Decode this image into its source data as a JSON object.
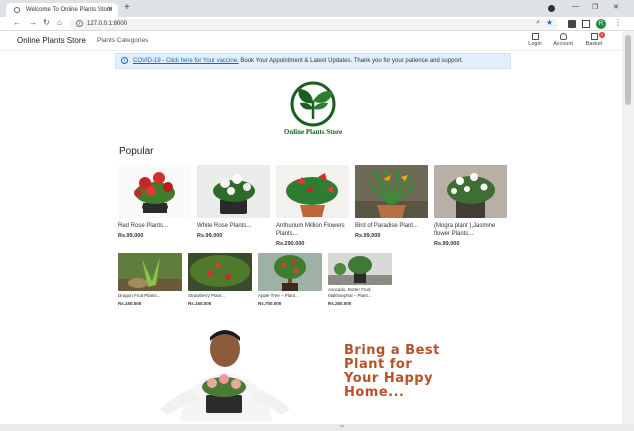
{
  "browser": {
    "tab_title": "Welcome To Online Plants Store",
    "url": "127.0.0.1:8000",
    "profile_initial": "R"
  },
  "nav": {
    "brand": "Online Plants Store",
    "categories": "Plants Categories",
    "login": "Login",
    "account": "Account",
    "basket": "Basket",
    "basket_count": "0"
  },
  "alert": {
    "link": "COVID-19 - Click here for Your vaccine.",
    "text": " Book Your Appointment & Latest Updates. Thank you for your patience and support."
  },
  "logo": {
    "text": "Online Plants Store"
  },
  "popular": {
    "title": "Popular",
    "items": [
      {
        "name": "Red Rose Plants...",
        "price": "Rs.99.000"
      },
      {
        "name": "White Rose Plants...",
        "price": "Rs.99.000"
      },
      {
        "name": "Anthurium Million Flowers Plants...",
        "price": "Rs.290.000"
      },
      {
        "name": "Bird of Paradise Plant...",
        "price": "Rs.99.000"
      },
      {
        "name": "(Mogra plant ),Jasmine flower Plants...",
        "price": "Rs.99.000"
      },
      {
        "name": "Dragon Fruit Plants...",
        "price": "Rs.150.000"
      },
      {
        "name": "Strawberry Plant...",
        "price": "Rs.150.000"
      },
      {
        "name": "Apple Tree – Plant...",
        "price": "Rs.700.000"
      },
      {
        "name": "Avocado, Butter Fruit, Makhanphal – Plant...",
        "price": "Rs.250.000"
      }
    ]
  },
  "hero": {
    "tagline": "Bring a Best\nPlant for\nYour Happy\nHome..."
  },
  "colors": {
    "brand_green": "#1b5e20",
    "tagline": "#b5522a",
    "alert_bg": "#e1effc",
    "link": "#1565c0"
  }
}
